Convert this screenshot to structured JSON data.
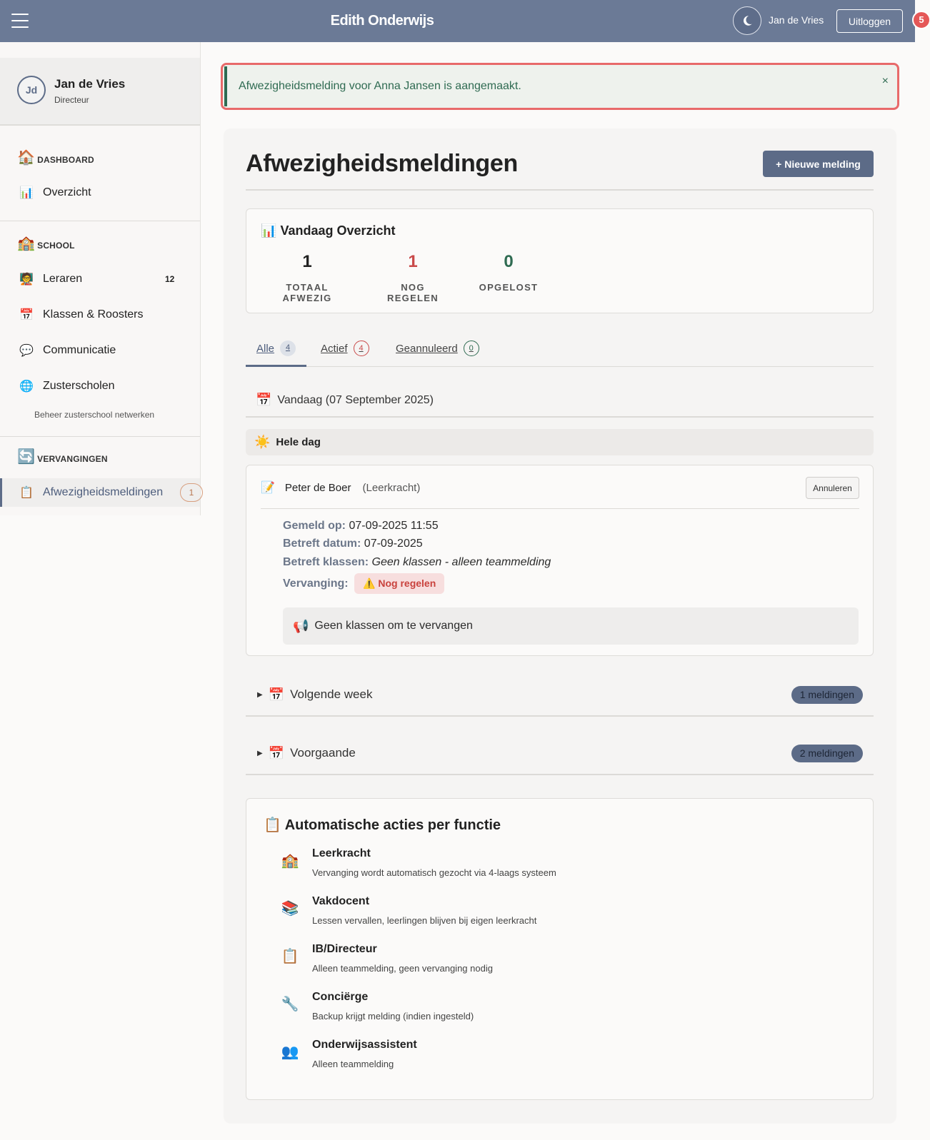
{
  "header": {
    "app_title": "Edith Onderwijs",
    "user_name": "Jan de Vries",
    "logout_label": "Uitloggen",
    "notification_count": "5"
  },
  "sidebar": {
    "profile": {
      "initials": "Jd",
      "name": "Jan de Vries",
      "role": "Directeur"
    },
    "sections": [
      {
        "label": "DASHBOARD",
        "icon": "house-icon"
      },
      {
        "label": "SCHOOL",
        "icon": "school-icon"
      },
      {
        "label": "VERVANGINGEN",
        "icon": "refresh-icon"
      }
    ],
    "items": [
      {
        "label": "Overzicht",
        "icon": "bar-chart-icon"
      },
      {
        "label": "Leraren",
        "icon": "teacher-icon",
        "count": "12"
      },
      {
        "label": "Klassen & Roosters",
        "icon": "calendar-icon"
      },
      {
        "label": "Communicatie",
        "icon": "speech-bubble-icon"
      },
      {
        "label": "Zusterscholen",
        "icon": "globe-icon",
        "hint": "Beheer zusterschool netwerken"
      },
      {
        "label": "Afwezigheidsmeldingen",
        "icon": "clipboard-icon",
        "badge": "1"
      }
    ]
  },
  "alert": {
    "message": "Afwezigheidsmelding voor Anna Jansen is aangemaakt.",
    "close": "×"
  },
  "main": {
    "title": "Afwezigheidsmeldingen",
    "new_button": "+  Nieuwe melding",
    "overview": {
      "title": "Vandaag Overzicht",
      "stats": [
        {
          "value": "1",
          "label": "TOTAAL AFWEZIG",
          "color": "#222222"
        },
        {
          "value": "1",
          "label": "NOG REGELEN",
          "color": "#c94a4a"
        },
        {
          "value": "0",
          "label": "OPGELOST",
          "color": "#2f6b52"
        }
      ]
    },
    "tabs": [
      {
        "label": "Alle",
        "count": "4"
      },
      {
        "label": "Actief",
        "count": "4"
      },
      {
        "label": "Geannuleerd",
        "count": "0"
      }
    ],
    "today_header": "Vandaag (07 September 2025)",
    "allday_label": "Hele dag",
    "absence": {
      "name": "Peter de Boer",
      "role": "(Leerkracht)",
      "cancel_label": "Annuleren",
      "reported_label": "Gemeld op:",
      "reported_value": " 07-09-2025 11:55",
      "date_label": "Betreft datum:",
      "date_value": " 07-09-2025",
      "classes_label": "Betreft klassen:",
      "classes_value": " Geen klassen - alleen teammelding",
      "replacement_label": "Vervanging:",
      "replacement_status": "⚠️ Nog regelen",
      "note": "Geen klassen om te vervangen"
    },
    "groups": [
      {
        "label": "Volgende week",
        "badge": "1 meldingen"
      },
      {
        "label": "Voorgaande",
        "badge": "2 meldingen"
      }
    ],
    "auto_actions": {
      "title": "Automatische acties per functie",
      "items": [
        {
          "name": "Leerkracht",
          "desc": "Vervanging wordt automatisch gezocht via 4-laags systeem",
          "icon": "school-icon"
        },
        {
          "name": "Vakdocent",
          "desc": "Lessen vervallen, leerlingen blijven bij eigen leerkracht",
          "icon": "books-icon"
        },
        {
          "name": "IB/Directeur",
          "desc": "Alleen teammelding, geen vervanging nodig",
          "icon": "clipboard-icon"
        },
        {
          "name": "Conciërge",
          "desc": "Backup krijgt melding (indien ingesteld)",
          "icon": "wrench-icon"
        },
        {
          "name": "Onderwijsassistent",
          "desc": "Alleen teammelding",
          "icon": "people-icon"
        }
      ]
    }
  }
}
